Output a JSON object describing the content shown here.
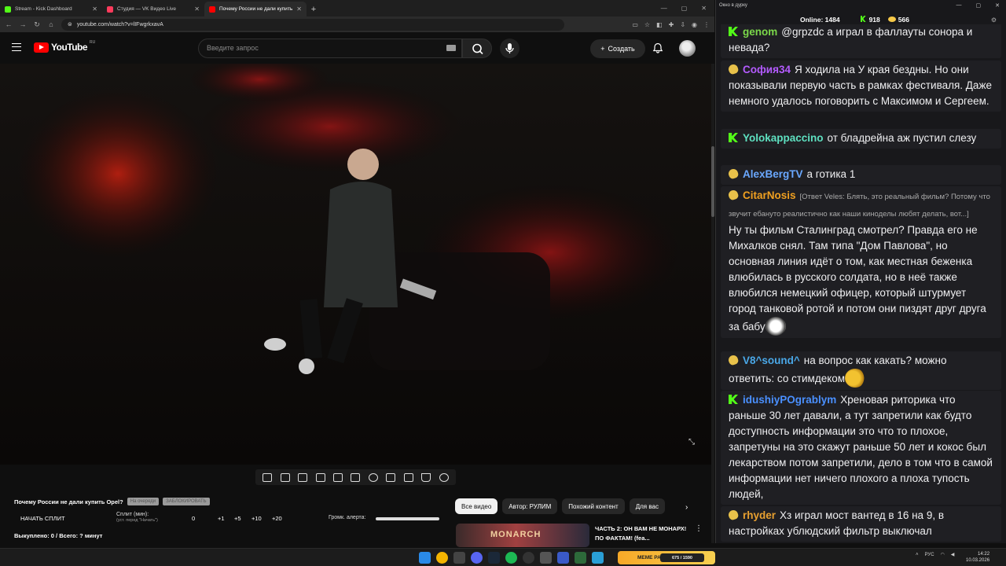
{
  "browser": {
    "tabs": [
      {
        "title": "Stream - Kick Dashboard",
        "color": "#53fc18"
      },
      {
        "title": "Студия — VK Видео Live",
        "color": "#ff3b5c"
      },
      {
        "title": "Почему России не дали купить",
        "color": "#ff0000"
      }
    ],
    "url": "youtube.com/watch?v=lIFwgrkxavA"
  },
  "youtube": {
    "logo_text": "YouTube",
    "logo_region": "RU",
    "search_placeholder": "Введите запрос",
    "create_label": "Создать"
  },
  "toolbar": {
    "icons": [
      "loop-icon",
      "broadcast-icon",
      "eye-icon",
      "film-icon",
      "picture-icon",
      "subtitles-icon",
      "speed-icon",
      "screenshot-plus-icon",
      "camera-icon",
      "flask-icon",
      "gear-icon"
    ]
  },
  "below": {
    "video_title": "Почему России не дали купить Opel?",
    "chip1": "На очереди",
    "chip2": "ЗАБЛОКИРОВАТЬ",
    "split_button": "НАЧАТЬ СПЛИТ",
    "split_label": "Сплит (мин):",
    "split_hint": "(уст. перед \"Начать\")",
    "steps": [
      "0",
      "+1",
      "+5",
      "+10",
      "+20"
    ],
    "volume_label": "Громк. алерта:",
    "bought": "Выкуплено: 0 / Всего: ? минут",
    "volume_level": 1.0
  },
  "recommend": {
    "chips": [
      "Все видео",
      "Автор: РУЛИМ",
      "Похожий контент",
      "Для вас"
    ],
    "thumb_text": "MONARCH",
    "video_title": "ЧАСТЬ 2: ОН ВАМ НЕ МОНАРХ! ПО ФАКТАМ! (fea..."
  },
  "chat": {
    "window_title": "Окно в дурку",
    "online_label": "Online:",
    "online_count": "1484",
    "kick_count": "918",
    "vk_count": "566",
    "messages": [
      {
        "badge": "k",
        "user": "genom",
        "color": "#7bd84a",
        "text": "@grpzdc а играл в фаллауты сонора и невада?"
      },
      {
        "badge": "vk",
        "user": "София34",
        "color": "#b45bff",
        "text": "Я ходила на У края бездны. Но они показывали первую часть в рамках фестиваля. Даже немного удалось поговорить с Максимом и Сергеем."
      },
      {
        "badge": "k",
        "user": "Yolokappaccino",
        "color": "#5ee0c0",
        "text": "от бладрейна аж пустил слезу"
      },
      {
        "badge": "vk",
        "user": "AlexBergTV",
        "color": "#6aa8ff",
        "text": "а готика 1"
      },
      {
        "badge": "vk",
        "user": "CitarNosis",
        "color": "#f0a020",
        "reply": "[Ответ Veles: Блять, это реальный фильм? Потому что звучит ебануто реалистично как наши киноделы любят делать, вот...]",
        "text": "Ну ты фильм Сталинград смотрел? Правда его не Михалков снял. Там типа \"Дом Павлова\", но основная линия идёт о том, как местная беженка влюбилась в русского солдата, но в неё также влюбился немецкий офицер, который штурмует город танковой ротой и потом они пиздят друг друга за бабу"
      },
      {
        "badge": "vk",
        "user": "V8^sound^",
        "color": "#4aa8e8",
        "text": "на вопрос как какать? можно ответить: со стимдеком"
      },
      {
        "badge": "k",
        "user": "idushiyPOgrablym",
        "color": "#4a90ff",
        "text": "Хреновая риторика что раньше 30 лет давали, а тут запретили как будто доступность информации это что то плохое, запретуны на это скажут раньше 50 лет и кокос был лекарством потом запретили, дело в том что в самой информации нет ничего плохого а плоха тупость людей,"
      },
      {
        "badge": "vk",
        "user": "rhyder",
        "color": "#e8a030",
        "text": "Хз играл мост вантед в 16 на 9, в настройках ублюдский фильтр выключал"
      }
    ]
  },
  "taskbar": {
    "banner_text": "MEME PARTY",
    "banner_count": "675 / 1590",
    "lang": "РУС",
    "time": "14:22",
    "date": "10.03.2026"
  }
}
